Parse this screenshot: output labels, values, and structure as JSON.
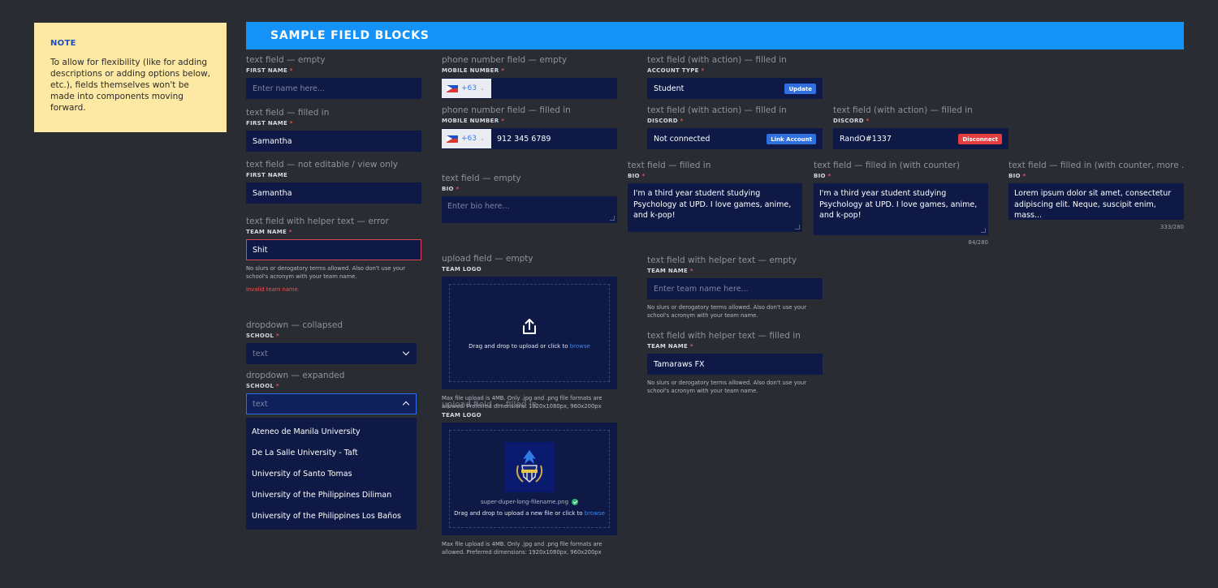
{
  "note": {
    "title": "NOTE",
    "body": "To allow for flexibility (like for adding descriptions or adding options below, etc.), fields themselves won't be made into components moving forward."
  },
  "banner": {
    "title": "SAMPLE FIELD BLOCKS"
  },
  "required_mark": "*",
  "col1": {
    "tf_empty": {
      "caption": "text field — empty",
      "label": "FIRST NAME",
      "placeholder": "Enter name here..."
    },
    "tf_filled": {
      "caption": "text field — filled in",
      "label": "FIRST NAME",
      "value": "Samantha"
    },
    "tf_readonly": {
      "caption": "text field — not editable / view only",
      "label": "FIRST NAME",
      "value": "Samantha"
    },
    "tf_error": {
      "caption": "text field with helper text — error",
      "label": "TEAM NAME",
      "value": "Shit",
      "helper": "No slurs or derogatory terms allowed. Also don't use your school's acronym with your team name.",
      "error": "Invalid team name."
    },
    "dd_collapsed": {
      "caption": "dropdown — collapsed",
      "label": "SCHOOL",
      "placeholder": "text"
    },
    "dd_expanded": {
      "caption": "dropdown — expanded",
      "label": "SCHOOL",
      "placeholder": "text",
      "options": [
        "Ateneo de Manila University",
        "De La Salle University - Taft",
        "University of Santo Tomas",
        "University of the Philippines Diliman",
        "University of the Philippines Los Baños"
      ]
    }
  },
  "col2": {
    "phone_empty": {
      "caption": "phone number field — empty",
      "label": "MOBILE NUMBER",
      "code": "+63",
      "value": ""
    },
    "phone_filled": {
      "caption": "phone number field — filled in",
      "label": "MOBILE NUMBER",
      "code": "+63",
      "value": "912 345 6789"
    },
    "bio_empty": {
      "caption": "text field — empty",
      "label": "BIO",
      "placeholder": "Enter bio here..."
    },
    "upload_empty": {
      "caption": "upload field — empty",
      "label": "TEAM LOGO",
      "prompt": "Drag and drop to upload or click to",
      "browse": "browse",
      "helper": "Max file upload is 4MB. Only .jpg and .png file formats are allowed. Preferred dimensions: 1920x1080px, 960x200px"
    },
    "upload_filled": {
      "caption": "upload field — filled in",
      "label": "TEAM LOGO",
      "filename": "super-duper-long-filename.png",
      "prompt": "Drag and drop to upload a new file or click to",
      "browse": "browse",
      "helper": "Max file upload is 4MB. Only .jpg and .png file formats are allowed. Preferred dimensions: 1920x1080px, 960x200px"
    }
  },
  "col3": {
    "action_account": {
      "caption": "text field (with action) — filled in",
      "label": "ACCOUNT TYPE",
      "value": "Student",
      "action": "Update"
    },
    "action_discord_empty": {
      "caption": "text field (with action) — filled in",
      "label": "DISCORD",
      "value": "Not connected",
      "action": "Link Account"
    },
    "bio_filled": {
      "caption": "text field — filled in",
      "label": "BIO",
      "value": "I'm a third year student studying Psychology at UPD. I love games, anime, and k-pop!"
    },
    "helper_empty": {
      "caption": "text field with helper text — empty",
      "label": "TEAM NAME",
      "placeholder": "Enter team name here...",
      "helper": "No slurs or derogatory terms allowed. Also don't use your school's acronym with your team name."
    },
    "helper_filled": {
      "caption": "text field with helper text — filled in",
      "label": "TEAM NAME",
      "value": "Tamaraws FX",
      "helper": "No slurs or derogatory terms allowed. Also don't use your school's acronym with your team name."
    }
  },
  "col4": {
    "action_discord_filled": {
      "caption": "text field (with action) — filled in",
      "label": "DISCORD",
      "value": "RandO#1337",
      "action": "Disconnect"
    },
    "bio_counter": {
      "caption": "text field — filled in (with counter)",
      "label": "BIO",
      "value": "I'm a third year student studying Psychology at UPD. I love games, anime, and k-pop!",
      "counter": "84/280"
    }
  },
  "col5": {
    "bio_counter_more": {
      "caption": "text field — filled in (with counter, more ...",
      "label": "BIO",
      "value": "Lorem ipsum dolor sit amet, consectetur adipiscing elit. Neque, suscipit enim, mass...",
      "counter": "333/280"
    }
  }
}
